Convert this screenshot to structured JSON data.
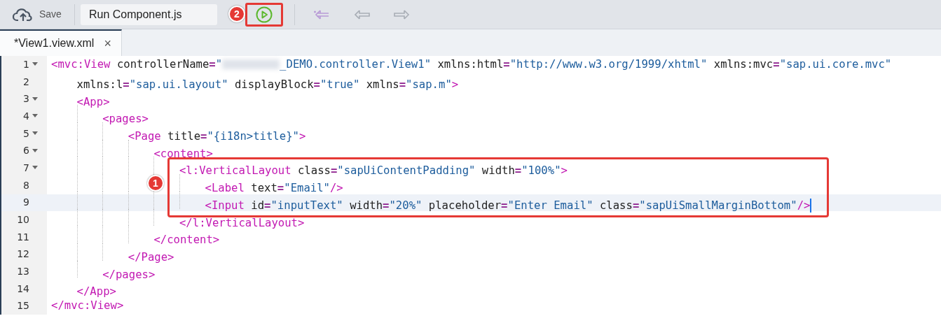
{
  "toolbar": {
    "save": {
      "label": "Save"
    },
    "run_config": {
      "value": "Run Component.js"
    },
    "run_callout": "2"
  },
  "tabs": [
    {
      "label": "*View1.view.xml",
      "close": "×",
      "selected": true
    }
  ],
  "editor": {
    "callout": "1",
    "lines": [
      {
        "number": "1",
        "foldable": true,
        "selected": false,
        "tokens": [
          {
            "kind": "tag",
            "text": "<mvc:View"
          },
          {
            "kind": "attr",
            "text": " controllerName"
          },
          {
            "kind": "eq",
            "text": "="
          },
          {
            "kind": "str",
            "text": "\""
          },
          {
            "kind": "blurred"
          },
          {
            "kind": "str",
            "text": "_DEMO.controller.View1\""
          },
          {
            "kind": "attr",
            "text": " xmlns:html"
          },
          {
            "kind": "eq",
            "text": "="
          },
          {
            "kind": "str",
            "text": "\"http://www.w3.org/1999/xhtml\""
          },
          {
            "kind": "attr",
            "text": " xmlns:mvc"
          },
          {
            "kind": "eq",
            "text": "="
          },
          {
            "kind": "str",
            "text": "\"sap.ui.core.mvc\""
          }
        ],
        "children": [
          {
            "number": "2",
            "foldable": false,
            "selected": false,
            "tokens": [
              {
                "kind": "attr",
                "text": "xmlns:l"
              },
              {
                "kind": "eq",
                "text": "="
              },
              {
                "kind": "str",
                "text": "\"sap.ui.layout\""
              },
              {
                "kind": "attr",
                "text": " displayBlock"
              },
              {
                "kind": "eq",
                "text": "="
              },
              {
                "kind": "str",
                "text": "\"true\""
              },
              {
                "kind": "attr",
                "text": " xmlns"
              },
              {
                "kind": "eq",
                "text": "="
              },
              {
                "kind": "str",
                "text": "\"sap.m\""
              },
              {
                "kind": "tag",
                "text": ">"
              }
            ]
          },
          {
            "number": "3",
            "foldable": true,
            "selected": false,
            "tokens": [
              {
                "kind": "tag",
                "text": "<App>"
              }
            ],
            "children": [
              {
                "number": "4",
                "foldable": true,
                "selected": false,
                "tokens": [
                  {
                    "kind": "tag",
                    "text": "<pages>"
                  }
                ],
                "children": [
                  {
                    "number": "5",
                    "foldable": true,
                    "selected": false,
                    "tokens": [
                      {
                        "kind": "tag",
                        "text": "<Page"
                      },
                      {
                        "kind": "attr",
                        "text": " title"
                      },
                      {
                        "kind": "eq",
                        "text": "="
                      },
                      {
                        "kind": "str",
                        "text": "\"{i18n>title}\""
                      },
                      {
                        "kind": "tag",
                        "text": ">"
                      }
                    ],
                    "children": [
                      {
                        "number": "6",
                        "foldable": true,
                        "selected": false,
                        "tokens": [
                          {
                            "kind": "tag",
                            "text": "<content>"
                          }
                        ],
                        "children": [
                          {
                            "number": "7",
                            "foldable": true,
                            "selected": false,
                            "tokens": [
                              {
                                "kind": "tag",
                                "text": "<l:VerticalLayout"
                              },
                              {
                                "kind": "attr",
                                "text": " class"
                              },
                              {
                                "kind": "eq",
                                "text": "="
                              },
                              {
                                "kind": "str",
                                "text": "\"sapUiContentPadding\""
                              },
                              {
                                "kind": "attr",
                                "text": " width"
                              },
                              {
                                "kind": "eq",
                                "text": "="
                              },
                              {
                                "kind": "str",
                                "text": "\"100%\""
                              },
                              {
                                "kind": "tag",
                                "text": ">"
                              }
                            ],
                            "children": [
                              {
                                "number": "8",
                                "foldable": false,
                                "selected": false,
                                "tokens": [
                                  {
                                    "kind": "tag",
                                    "text": "<Label"
                                  },
                                  {
                                    "kind": "attr",
                                    "text": " text"
                                  },
                                  {
                                    "kind": "eq",
                                    "text": "="
                                  },
                                  {
                                    "kind": "str",
                                    "text": "\"Email\""
                                  },
                                  {
                                    "kind": "tag",
                                    "text": "/>"
                                  }
                                ]
                              },
                              {
                                "number": "9",
                                "foldable": false,
                                "selected": true,
                                "tokens": [
                                  {
                                    "kind": "tag",
                                    "text": "<Input"
                                  },
                                  {
                                    "kind": "attr",
                                    "text": " id"
                                  },
                                  {
                                    "kind": "eq",
                                    "text": "="
                                  },
                                  {
                                    "kind": "str",
                                    "text": "\"inputText\""
                                  },
                                  {
                                    "kind": "attr",
                                    "text": " width"
                                  },
                                  {
                                    "kind": "eq",
                                    "text": "="
                                  },
                                  {
                                    "kind": "str",
                                    "text": "\"20%\""
                                  },
                                  {
                                    "kind": "attr",
                                    "text": " placeholder"
                                  },
                                  {
                                    "kind": "eq",
                                    "text": "="
                                  },
                                  {
                                    "kind": "str",
                                    "text": "\"Enter Email\""
                                  },
                                  {
                                    "kind": "attr",
                                    "text": " class"
                                  },
                                  {
                                    "kind": "eq",
                                    "text": "="
                                  },
                                  {
                                    "kind": "str",
                                    "text": "\"sapUiSmallMarginBottom\""
                                  },
                                  {
                                    "kind": "tag",
                                    "text": "/>"
                                  }
                                ]
                              }
                            ]
                          },
                          {
                            "number": "10",
                            "foldable": false,
                            "selected": false,
                            "tokens": [
                              {
                                "kind": "tag",
                                "text": "</l:VerticalLayout>"
                              }
                            ]
                          }
                        ]
                      },
                      {
                        "number": "11",
                        "foldable": false,
                        "selected": false,
                        "tokens": [
                          {
                            "kind": "tag",
                            "text": "</content>"
                          }
                        ]
                      }
                    ]
                  },
                  {
                    "number": "12",
                    "foldable": false,
                    "selected": false,
                    "tokens": [
                      {
                        "kind": "tag",
                        "text": "</Page>"
                      }
                    ]
                  }
                ]
              },
              {
                "number": "13",
                "foldable": false,
                "selected": false,
                "tokens": [
                  {
                    "kind": "tag",
                    "text": "</pages>"
                  }
                ]
              }
            ]
          },
          {
            "number": "14",
            "foldable": false,
            "selected": false,
            "tokens": [
              {
                "kind": "tag",
                "text": "</App>"
              }
            ]
          }
        ]
      },
      {
        "number": "15",
        "foldable": false,
        "selected": false,
        "tokens": [
          {
            "kind": "tag",
            "text": "</mvc:View>"
          }
        ]
      }
    ]
  }
}
